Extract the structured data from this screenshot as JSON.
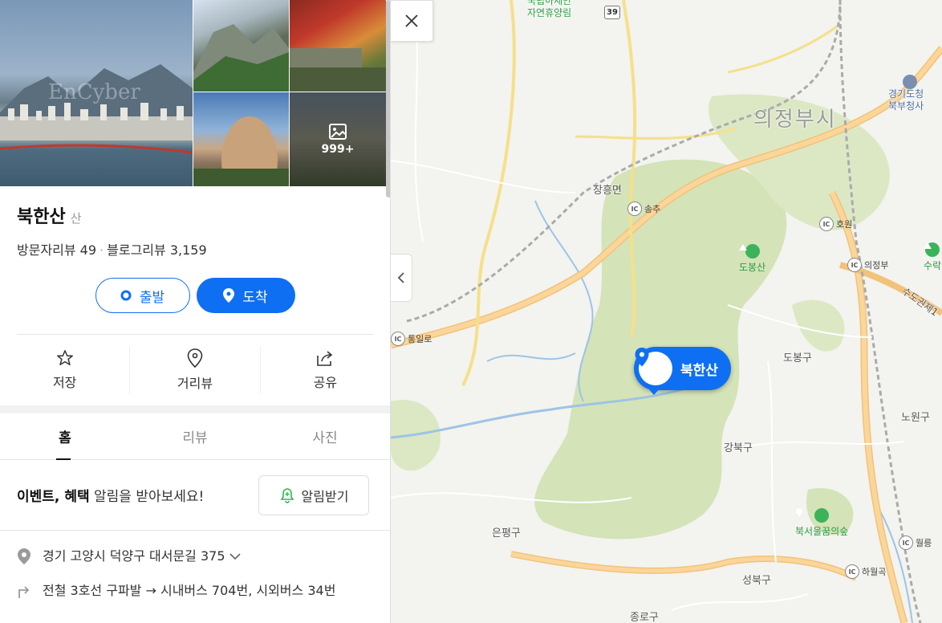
{
  "place": {
    "name": "북한산",
    "category": "산",
    "visitor_reviews": "방문자리뷰 49",
    "blog_reviews": "블로그리뷰 3,159",
    "photo_count": "999+",
    "watermark": "EnCyber"
  },
  "route": {
    "start_label": "출발",
    "arrive_label": "도착"
  },
  "actions": {
    "save": "저장",
    "streetview": "거리뷰",
    "share": "공유"
  },
  "tabs": {
    "home": "홈",
    "review": "리뷰",
    "photo": "사진"
  },
  "alert": {
    "bold1": "이벤트",
    "sep": ", ",
    "bold2": "혜택",
    "rest": " 알림을 받아보세요!",
    "button": "알림받기"
  },
  "details": {
    "address": "경기 고양시 덕양구 대서문길 375",
    "transit": "전철 3호선 구파발 → 시내버스 704번, 시외버스 34번"
  },
  "map": {
    "marker_label": "북한산",
    "labels": {
      "uijeongbu": "의정부시",
      "jangheung": "장흥면",
      "dobongsan": "도봉산",
      "dobonggu": "도봉구",
      "gangbukgu": "강북구",
      "eunpyeonggu": "은평구",
      "seongbukgu": "성북구",
      "jongnogu": "종로구",
      "nowongu": "노원구",
      "forest": "국립아세안\n자연휴양림",
      "bukseoul": "북서울꿈의숲",
      "suraksan": "수락",
      "gyeonggi": "경기도청\n북부청사",
      "sudogwon": "수도권제1"
    },
    "ic": {
      "songchu": "송추",
      "howon": "호원",
      "uijeongbu": "의정부",
      "tongilro": "통일로",
      "wolleung": "월릉",
      "hawolgok": "하월곡"
    },
    "route_num": "39"
  }
}
